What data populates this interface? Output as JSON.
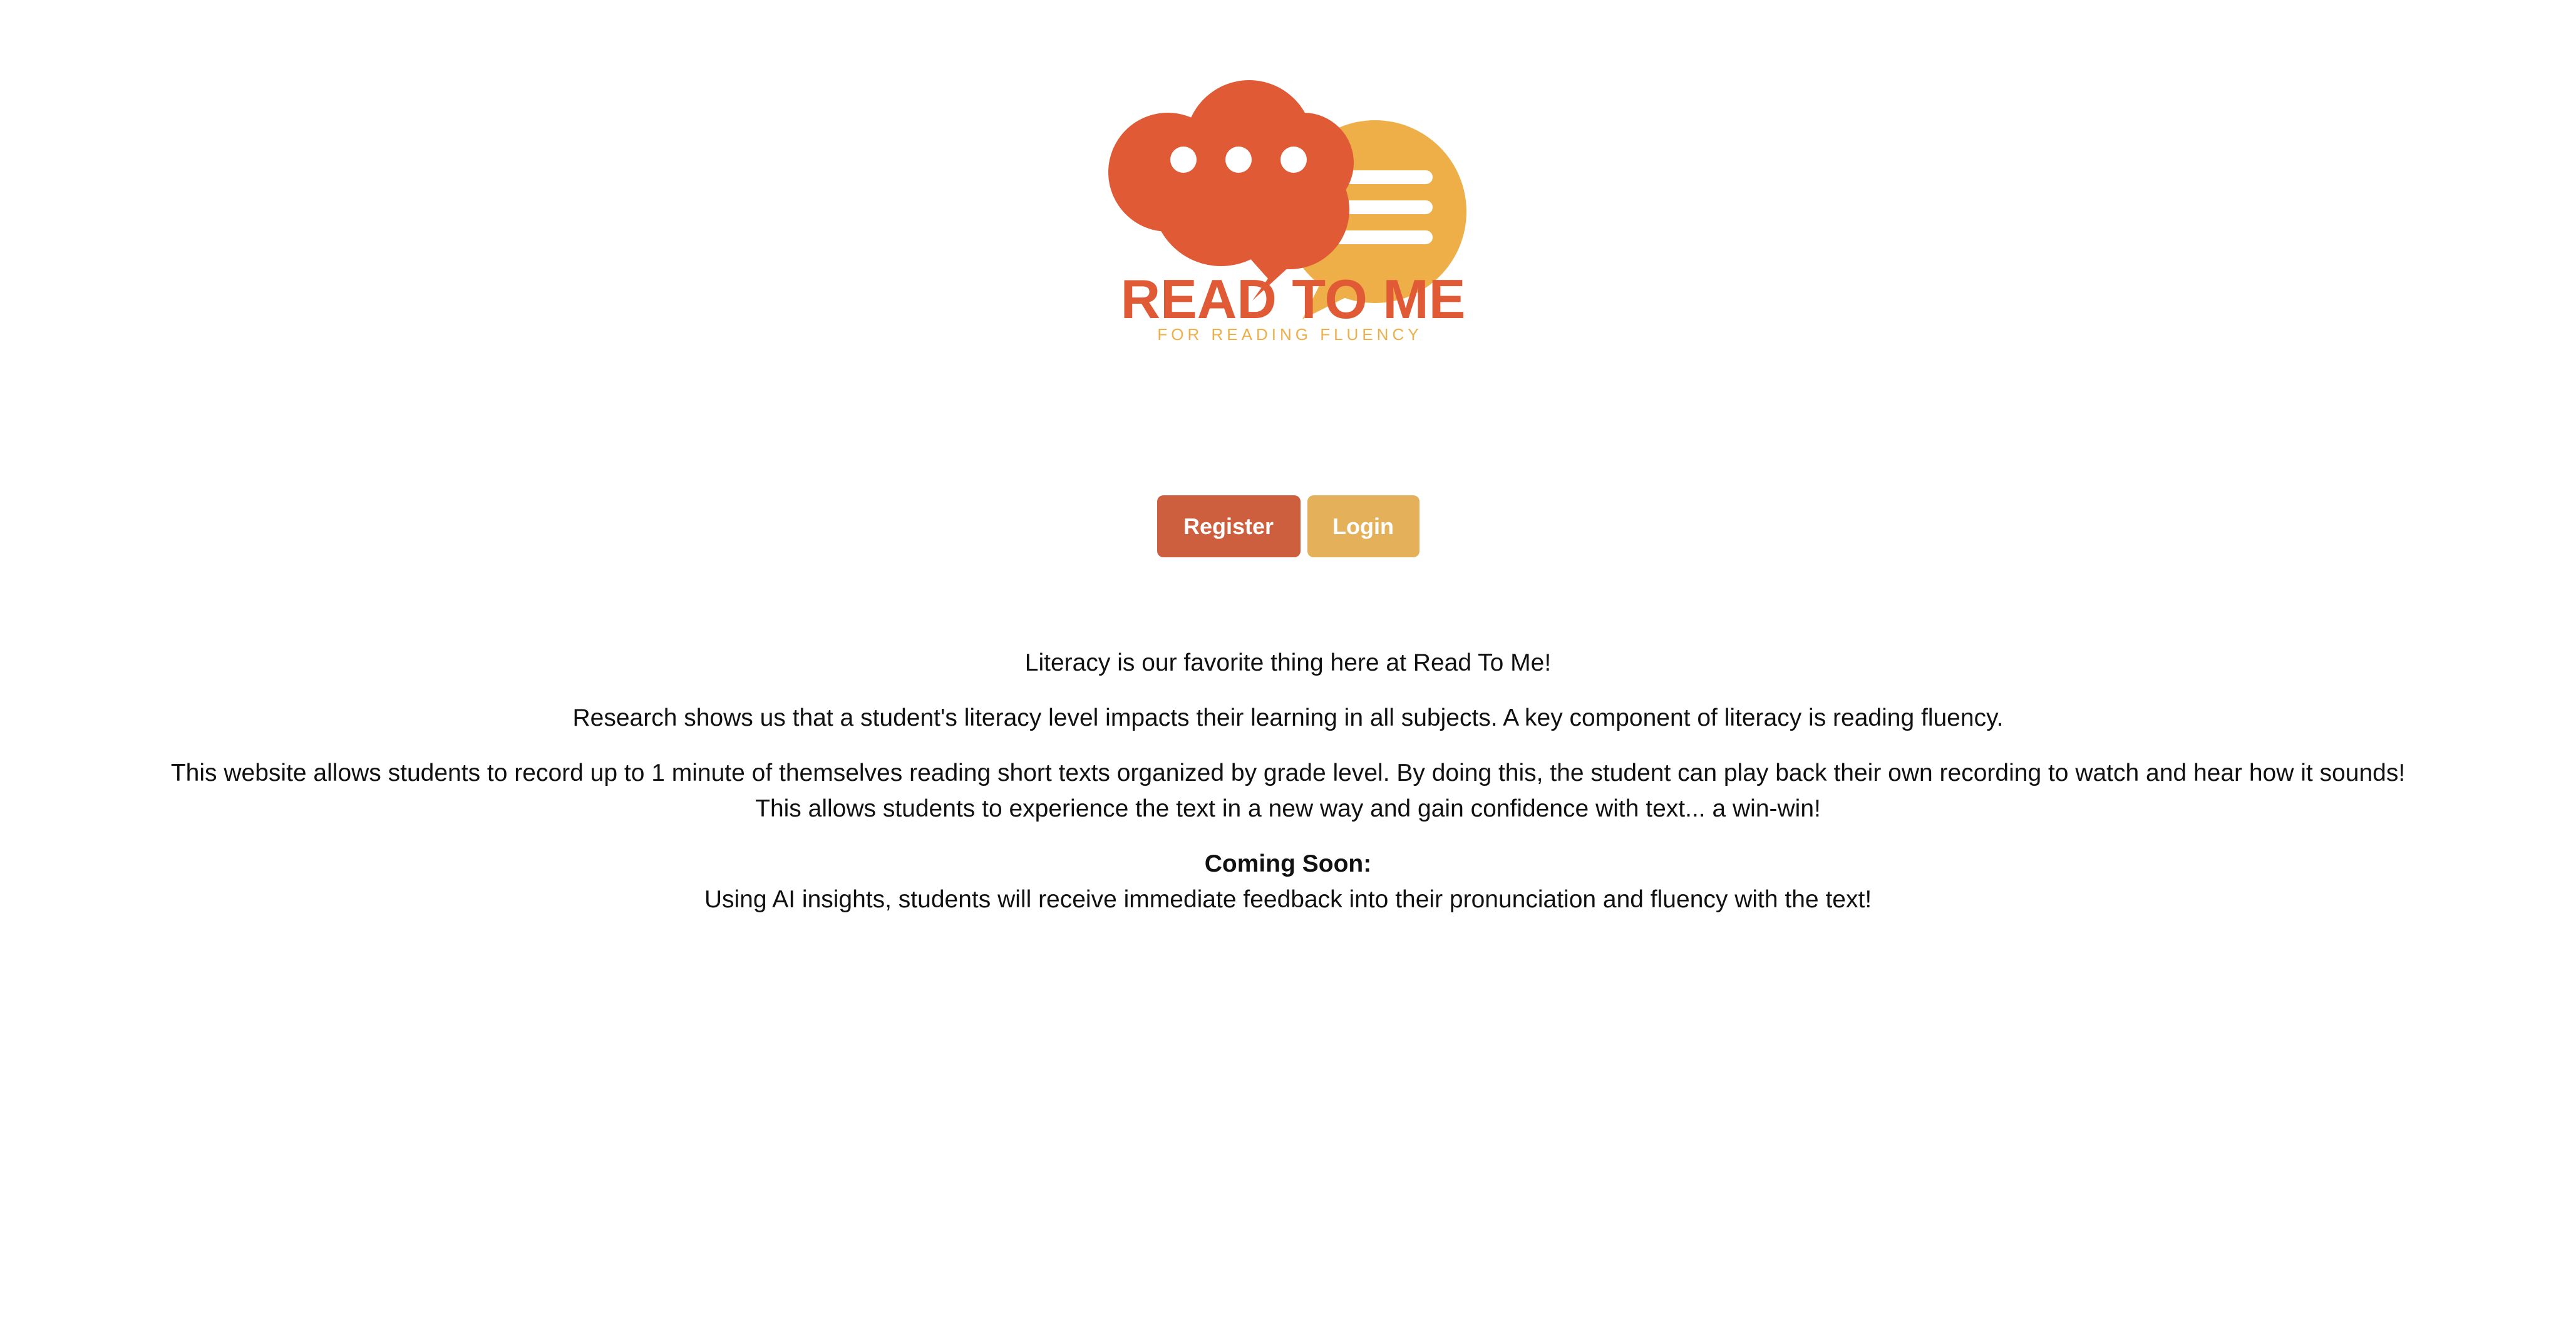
{
  "logo": {
    "title": "READ TO ME",
    "subtitle": "FOR READING FLUENCY",
    "colors": {
      "primary": "#e05a36",
      "secondary": "#eeaf48"
    }
  },
  "actions": {
    "register_label": "Register",
    "login_label": "Login",
    "register_color": "#cd5f3e",
    "login_color": "#e4b05a"
  },
  "content": {
    "intro": "Literacy is our favorite thing here at Read To Me!",
    "research": "Research shows us that a student's literacy level impacts their learning in all subjects. A key component of literacy is reading fluency.",
    "website_line1": "This website allows students to record up to 1 minute of themselves reading short texts organized by grade level. By doing this, the student can play back their own recording to watch and hear how it sounds!",
    "website_line2": "This allows students to experience the text in a new way and gain confidence with text... a win-win!",
    "coming_soon_heading": "Coming Soon:",
    "coming_soon_text": "Using AI insights, students will receive immediate feedback into their pronunciation and fluency with the text!"
  }
}
